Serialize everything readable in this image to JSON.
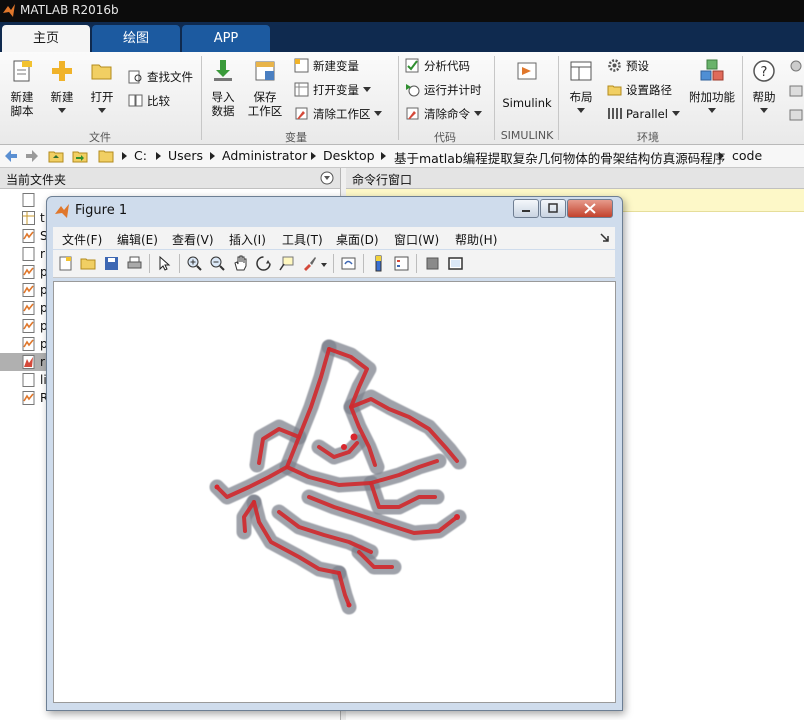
{
  "app": {
    "title": "MATLAB R2016b"
  },
  "tabs": [
    {
      "label": "主页",
      "active": true
    },
    {
      "label": "绘图",
      "active": false
    },
    {
      "label": "APP",
      "active": false
    }
  ],
  "ribbon": {
    "file": {
      "new_script": "新建\n脚本",
      "new": "新建",
      "open": "打开",
      "find_files": "查找文件",
      "compare": "比较",
      "group": "文件"
    },
    "variable": {
      "import": "导入\n数据",
      "save_workspace": "保存\n工作区",
      "new_variable": "新建变量",
      "open_variable": "打开变量",
      "clear_workspace": "清除工作区",
      "group": "变量"
    },
    "code": {
      "analyze": "分析代码",
      "run_time": "运行并计时",
      "clear_commands": "清除命令",
      "group": "代码"
    },
    "simulink": {
      "button": "Simulink",
      "group": "SIMULINK"
    },
    "environment": {
      "layout": "布局",
      "preferences": "预设",
      "set_path": "设置路径",
      "parallel": "Parallel",
      "addons": "附加功能",
      "group": "环境"
    },
    "help": "帮助"
  },
  "address": {
    "path": [
      "C:",
      "Users",
      "Administrator",
      "Desktop",
      "基于matlab编程提取复杂几何物体的骨架结构仿真源码程序",
      "code"
    ]
  },
  "panels": {
    "current_folder": "当前文件夹",
    "command_window": "命令行窗口"
  },
  "files": [
    {
      "name": "",
      "icon": "blank-file-icon"
    },
    {
      "name": "t",
      "icon": "figure-file-icon"
    },
    {
      "name": "S",
      "icon": "mfile-icon"
    },
    {
      "name": "r",
      "icon": "blank-file-icon"
    },
    {
      "name": "p",
      "icon": "mfile-icon"
    },
    {
      "name": "p",
      "icon": "mfile-icon"
    },
    {
      "name": "p",
      "icon": "mfile-icon"
    },
    {
      "name": "p",
      "icon": "mfile-icon"
    },
    {
      "name": "p",
      "icon": "mfile-icon"
    },
    {
      "name": "r",
      "icon": "mlx-file-icon",
      "selected": true
    },
    {
      "name": "li",
      "icon": "blank-file-icon"
    },
    {
      "name": "R",
      "icon": "mfile-icon"
    }
  ],
  "figure": {
    "title": "Figure 1",
    "menus": [
      "文件(F)",
      "编辑(E)",
      "查看(V)",
      "插入(I)",
      "工具(T)",
      "桌面(D)",
      "窗口(W)",
      "帮助(H)"
    ],
    "toolbar_icons": [
      "new-figure-icon",
      "open-icon",
      "save-icon",
      "print-icon",
      "pointer-icon",
      "zoom-in-icon",
      "zoom-out-icon",
      "pan-icon",
      "rotate-3d-icon",
      "data-cursor-icon",
      "brush-icon",
      "link-plot-icon",
      "colorbar-icon",
      "legend-icon",
      "hide-plot-tools-icon",
      "show-plot-tools-icon"
    ]
  },
  "colors": {
    "skeleton": "#d42a2a",
    "volume": "#8a8f99",
    "tab_active_bg": "#f5f5f5",
    "titlebar": "#0c0c0c"
  }
}
